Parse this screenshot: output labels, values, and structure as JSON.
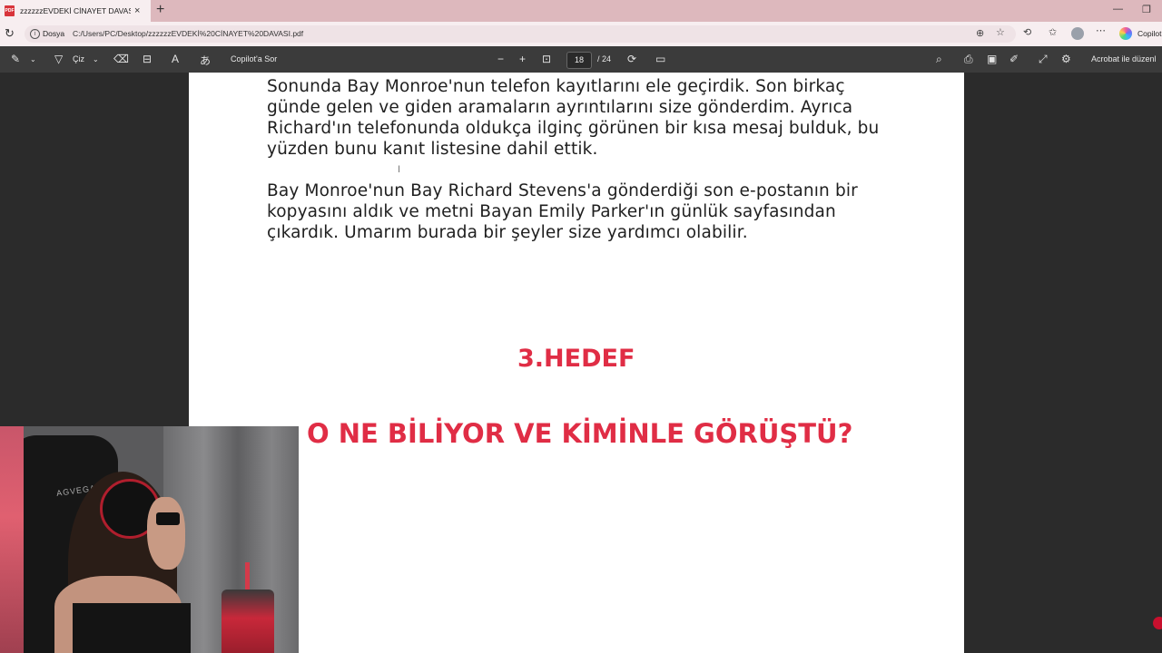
{
  "browser": {
    "tab_title": "zzzzzzEVDEKİ CİNAYET DAVASI.pd",
    "tab_close": "×",
    "new_tab": "+",
    "address_label": "Dosya",
    "url": "C:/Users/PC/Desktop/zzzzzzEVDEKİ%20CİNAYET%20DAVASI.pdf",
    "copilot_label": "Copilot"
  },
  "pdf_toolbar": {
    "draw_label": "Çiz",
    "ask_copilot": "Copilot'a Sor",
    "zoom_out": "−",
    "zoom_in": "+",
    "current_page": "18",
    "total_pages": "/ 24",
    "acrobat_label": "Acrobat ile düzenl"
  },
  "document": {
    "paragraph1": "Sonunda Bay Monroe'nun telefon kayıtlarını ele geçirdik. Son birkaç günde gelen ve giden aramaların ayrıntılarını size gönderdim. Ayrıca Richard'ın telefonunda oldukça ilginç görünen bir kısa mesaj bulduk, bu yüzden bunu kanıt listesine dahil ettik.",
    "paragraph2": "Bay Monroe'nun Bay Richard Stevens'a gönderdiği son e-postanın bir kopyasını aldık ve metni Bayan Emily Parker'ın günlük sayfasından çıkardık. Umarım burada bir şeyler size yardımcı olabilir.",
    "heading1": "3.HEDEF",
    "heading2": "O NE BİLİYOR VE KİMİNLE GÖRÜŞTÜ?",
    "heading_color": "#e02d45"
  },
  "webcam": {
    "chair_brand": "AGVEGA"
  },
  "icons": [
    "info-icon",
    "reload-icon",
    "zoom-icon",
    "star-icon",
    "refresh-icon",
    "favorites-icon",
    "profile-icon",
    "more-icon",
    "highlight-icon",
    "draw-icon",
    "erase-icon",
    "text-icon",
    "read-aloud-icon",
    "translate-icon",
    "fit-page-icon",
    "rotate-icon",
    "two-page-icon",
    "search-icon",
    "print-icon",
    "save-icon",
    "save-as-icon",
    "fullscreen-icon",
    "settings-icon"
  ]
}
